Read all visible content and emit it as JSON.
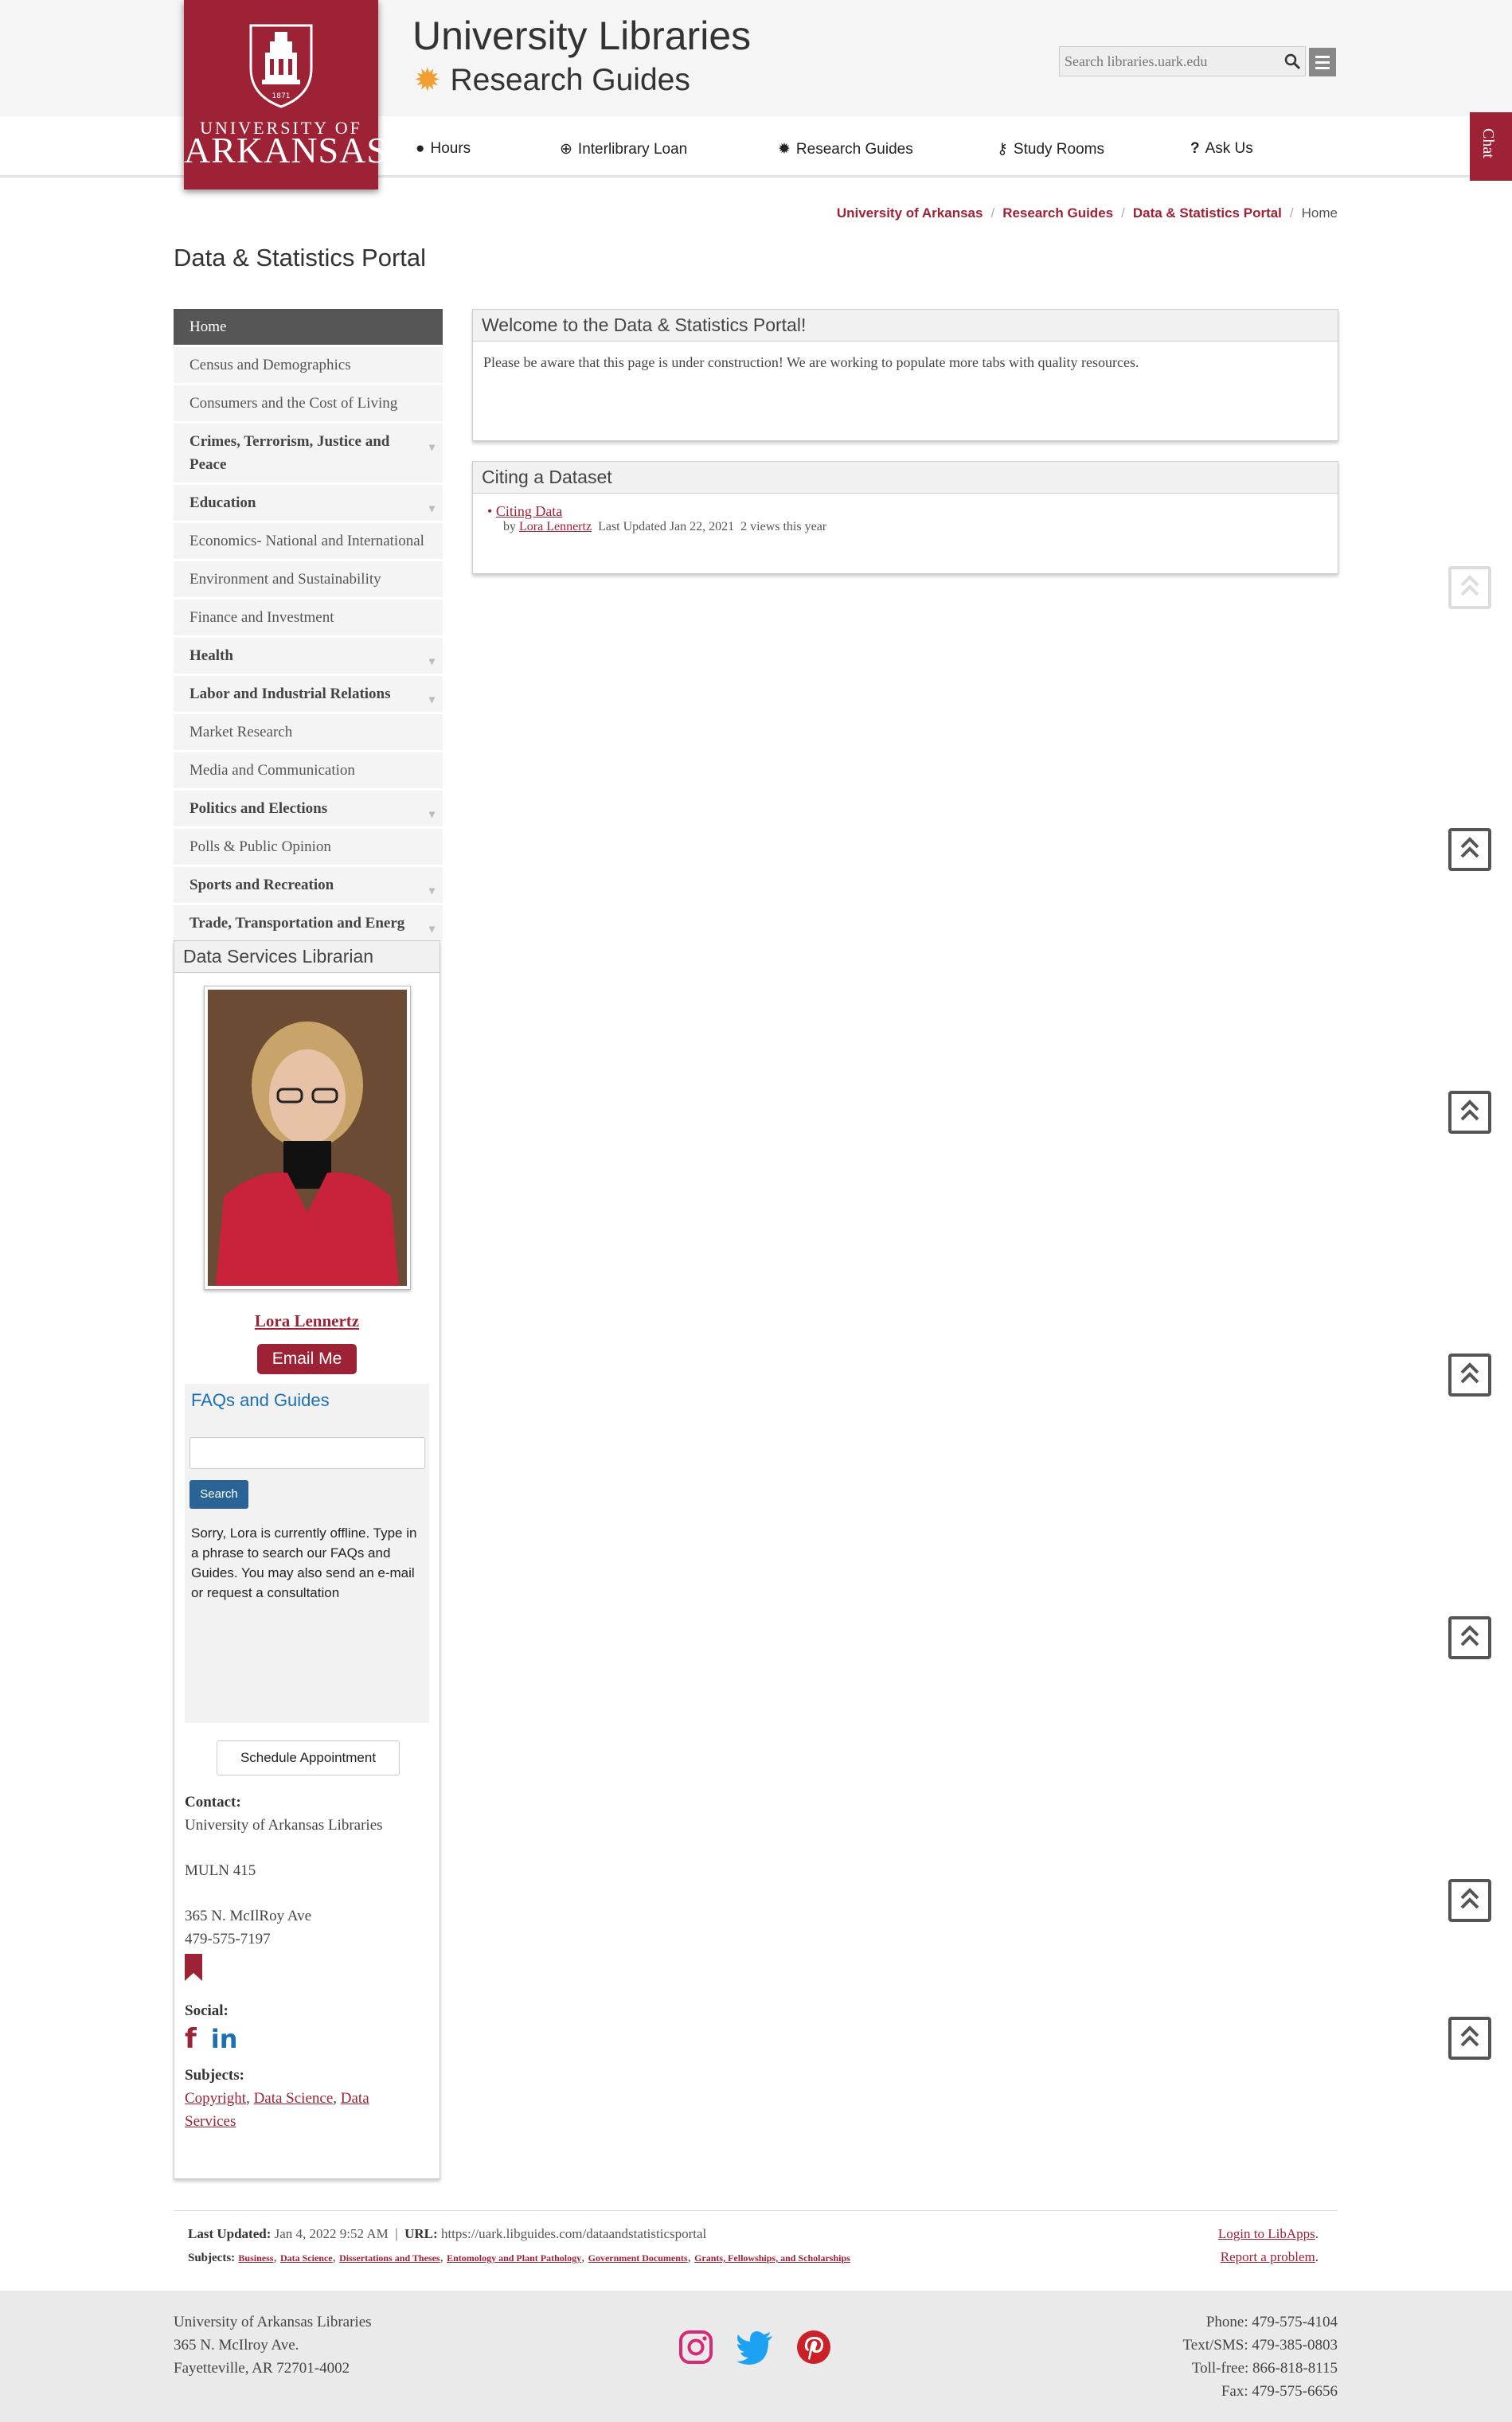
{
  "header": {
    "logo": {
      "line1": "UNIVERSITY OF",
      "line2": "ARKANSAS"
    },
    "title": "University Libraries",
    "subtitle": "Research Guides",
    "search_placeholder": "Search libraries.uark.edu"
  },
  "nav": [
    {
      "label": "Hours",
      "icon": "clock-icon"
    },
    {
      "label": "Interlibrary Loan",
      "icon": "globe-icon"
    },
    {
      "label": "Research Guides",
      "icon": "sun-icon"
    },
    {
      "label": "Study Rooms",
      "icon": "key-icon"
    },
    {
      "label": "Ask Us",
      "icon": "question-icon"
    }
  ],
  "chat_label": "Chat",
  "breadcrumb": [
    "University of Arkansas",
    "Research Guides",
    "Data & Statistics Portal",
    "Home"
  ],
  "page_title": "Data & Statistics Portal",
  "sidenav": [
    {
      "label": "Home",
      "active": true,
      "bold": false,
      "caret": false
    },
    {
      "label": "Census and Demographics",
      "bold": false,
      "caret": false
    },
    {
      "label": "Consumers and the Cost of Living",
      "bold": false,
      "caret": false
    },
    {
      "label": "Crimes, Terrorism, Justice and Peace",
      "bold": true,
      "caret": true
    },
    {
      "label": "Education",
      "bold": true,
      "caret": true
    },
    {
      "label": "Economics- National and International",
      "bold": false,
      "caret": false
    },
    {
      "label": "Environment and Sustainability",
      "bold": false,
      "caret": false
    },
    {
      "label": "Finance and Investment",
      "bold": false,
      "caret": false
    },
    {
      "label": "Health",
      "bold": true,
      "caret": true
    },
    {
      "label": "Labor and Industrial Relations",
      "bold": true,
      "caret": true
    },
    {
      "label": "Market Research",
      "bold": false,
      "caret": false
    },
    {
      "label": "Media and Communication",
      "bold": false,
      "caret": false
    },
    {
      "label": "Politics and Elections",
      "bold": true,
      "caret": true
    },
    {
      "label": "Polls & Public Opinion",
      "bold": false,
      "caret": false
    },
    {
      "label": "Sports and Recreation",
      "bold": true,
      "caret": true
    },
    {
      "label": "Trade, Transportation and Energ",
      "bold": true,
      "caret": true
    }
  ],
  "welcome": {
    "title": "Welcome to the Data & Statistics Portal!",
    "body": "Please be aware that this page is under construction!  We are working to populate more tabs with quality resources."
  },
  "citing": {
    "title": "Citing a Dataset",
    "link": "Citing Data",
    "by": "by",
    "author": "Lora Lennertz",
    "updated": "Last Updated Jan 22, 2021",
    "views": "2 views this year"
  },
  "librarian": {
    "title": "Data Services Librarian",
    "name": "Lora Lennertz",
    "email_btn": "Email Me",
    "faq_title": "FAQs and Guides",
    "faq_search": "Search",
    "faq_msg": "Sorry, Lora is currently offline. Type in a phrase to search our FAQs and Guides. You may also send an e-mail or request a consultation",
    "schedule_btn": "Schedule Appointment",
    "contact_label": "Contact:",
    "contact_org": "University of Arkansas Libraries",
    "contact_room": "MULN 415",
    "contact_addr": "365 N. McIlRoy Ave",
    "contact_phone": "479-575-7197",
    "social_label": "Social:",
    "subjects_label": "Subjects:",
    "subjects": [
      "Copyright",
      "Data Science",
      "Data Services"
    ]
  },
  "meta": {
    "last_updated_label": "Last Updated:",
    "last_updated": "Jan 4, 2022 9:52 AM",
    "url_label": "URL:",
    "url": "https://uark.libguides.com/dataandstatisticsportal",
    "subjects_label": "Subjects:",
    "subjects": [
      "Business",
      "Data Science",
      "Dissertations and Theses",
      "Entomology and Plant Pathology",
      "Government Documents",
      "Grants, Fellowships, and Scholarships"
    ],
    "login": "Login to LibApps",
    "report": "Report a problem"
  },
  "footer": {
    "org": "University of Arkansas Libraries",
    "addr1": "365 N. McIlroy Ave.",
    "addr2": "Fayetteville, AR 72701-4002",
    "phone": "Phone: 479-575-4104",
    "sms": "Text/SMS: 479-385-0803",
    "tollfree": "Toll-free: 866-818-8115",
    "fax": "Fax: 479-575-6656"
  },
  "colors": {
    "brand": "#9d2235",
    "accent": "#f0a030",
    "link_blue": "#1c6fb1"
  }
}
